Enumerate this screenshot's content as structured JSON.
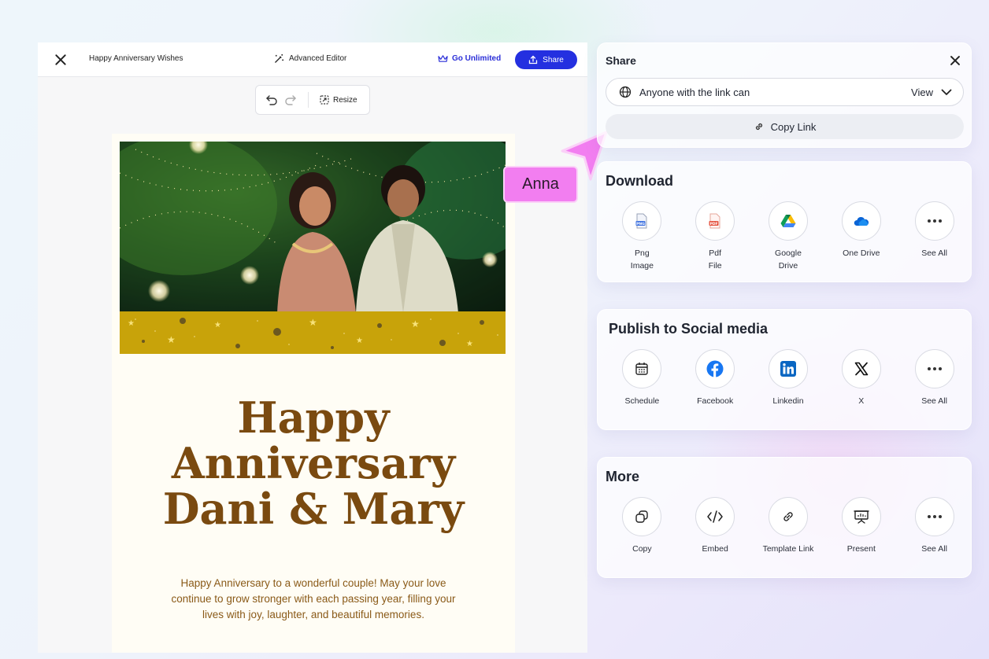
{
  "editor": {
    "doc_title": "Happy Anniversary Wishes",
    "advanced_editor": "Advanced Editor",
    "go_unlimited": "Go Unlimited",
    "share": "Share",
    "resize": "Resize"
  },
  "card": {
    "title_line1": "Happy",
    "title_line2": "Anniversary",
    "title_line3": "Dani & Mary",
    "message": "Happy Anniversary to a wonderful couple! May your love continue to grow stronger with each passing year, filling your lives with joy, laughter, and beautiful memories."
  },
  "collaborator": {
    "name": "Anna",
    "color": "#f27ef0"
  },
  "share_panel": {
    "title": "Share",
    "access_label": "Anyone with the link can",
    "permission": "View",
    "copy_link": "Copy Link"
  },
  "download": {
    "title": "Download",
    "items": [
      {
        "label1": "Png",
        "label2": "Image",
        "icon": "png-file-icon"
      },
      {
        "label1": "Pdf",
        "label2": "File",
        "icon": "pdf-file-icon"
      },
      {
        "label1": "Google",
        "label2": "Drive",
        "icon": "google-drive-icon"
      },
      {
        "label1": "One Drive",
        "label2": "",
        "icon": "onedrive-icon"
      },
      {
        "label1": "See All",
        "label2": "",
        "icon": "more-icon"
      }
    ]
  },
  "social": {
    "title": "Publish to Social media",
    "items": [
      {
        "label1": "Schedule",
        "icon": "calendar-icon"
      },
      {
        "label1": "Facebook",
        "icon": "facebook-icon"
      },
      {
        "label1": "Linkedin",
        "icon": "linkedin-icon"
      },
      {
        "label1": "X",
        "icon": "x-icon"
      },
      {
        "label1": "See All",
        "icon": "more-icon"
      }
    ]
  },
  "more": {
    "title": "More",
    "items": [
      {
        "label1": "Copy",
        "icon": "copy-icon"
      },
      {
        "label1": "Embed",
        "icon": "code-icon"
      },
      {
        "label1": "Template Link",
        "icon": "link-icon"
      },
      {
        "label1": "Present",
        "icon": "present-icon"
      },
      {
        "label1": "See All",
        "icon": "more-icon"
      }
    ]
  },
  "colors": {
    "accent": "#2430e0",
    "card_text": "#7a4a10",
    "banner": "#c8a30a"
  }
}
